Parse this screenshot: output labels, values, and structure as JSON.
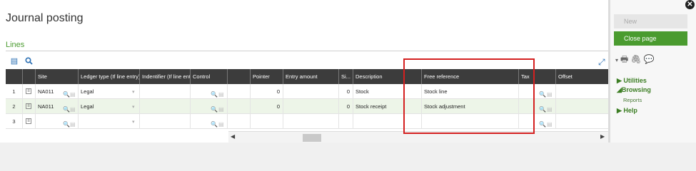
{
  "page": {
    "title": "Journal posting",
    "section_label": "Lines"
  },
  "toolbar": {
    "list_icon": "list-icon",
    "search_icon": "search-icon",
    "expand_icon": "expand-icon"
  },
  "grid": {
    "columns": [
      "Site",
      "Ledger type (If line entry)",
      "Indentifier (If line entr...",
      "Control",
      "Pointer",
      "Entry amount",
      "Si...",
      "Description",
      "Free reference",
      "Tax",
      "Offset"
    ],
    "rows": [
      {
        "num": "1",
        "site": "NA011",
        "ledger": "Legal",
        "pointer": "0",
        "si": "0",
        "description": "Stock",
        "free_ref": "Stock line"
      },
      {
        "num": "2",
        "site": "NA011",
        "ledger": "Legal",
        "pointer": "0",
        "si": "0",
        "description": "Stock receipt",
        "free_ref": "Stock adjustment"
      },
      {
        "num": "3",
        "site": "",
        "ledger": "",
        "pointer": "",
        "si": "",
        "description": "",
        "free_ref": ""
      }
    ]
  },
  "sidebar": {
    "new_label": "New",
    "close_label": "Close page",
    "menu": {
      "utilities": "Utilities",
      "browsing": "Browsing",
      "reports": "Reports",
      "help": "Help"
    }
  },
  "colors": {
    "accent": "#4a9b2f",
    "header_bg": "#3c3c3c",
    "highlight_frame": "#d42020"
  }
}
